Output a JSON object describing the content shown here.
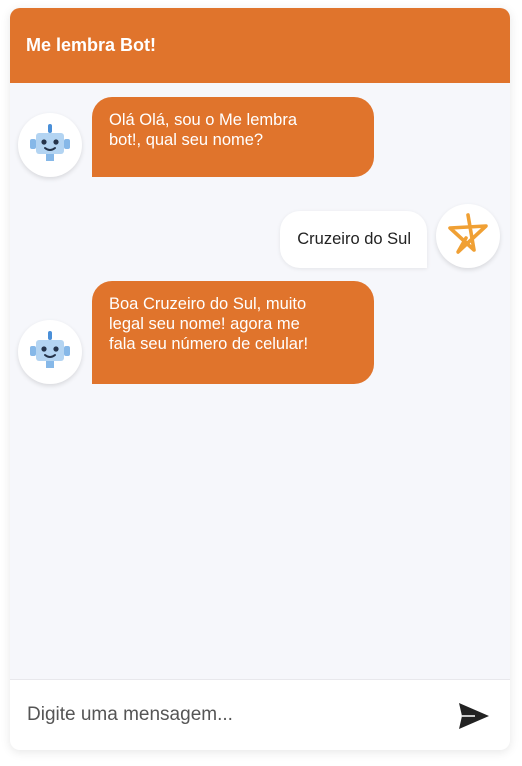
{
  "header": {
    "title": "Me lembra Bot!"
  },
  "messages": [
    {
      "sender": "bot",
      "avatar_icon": "robot-icon",
      "lines": [
        "Olá Olá, sou o Me lembra",
        "bot!, qual seu nome?"
      ]
    },
    {
      "sender": "user",
      "avatar_icon": "star-icon",
      "lines": [
        "Cruzeiro do Sul"
      ]
    },
    {
      "sender": "bot",
      "avatar_icon": "robot-icon",
      "lines": [
        "Boa Cruzeiro do Sul, muito",
        "legal seu nome! agora me",
        "fala seu número de celular!"
      ]
    }
  ],
  "input": {
    "placeholder": "Digite uma mensagem...",
    "value": "",
    "send_icon": "send-icon"
  },
  "colors": {
    "accent": "#e0742c",
    "background": "#f6f7fb",
    "user_bubble": "#ffffff",
    "star": "#f0a034",
    "robot_body": "#b3d4f2"
  }
}
